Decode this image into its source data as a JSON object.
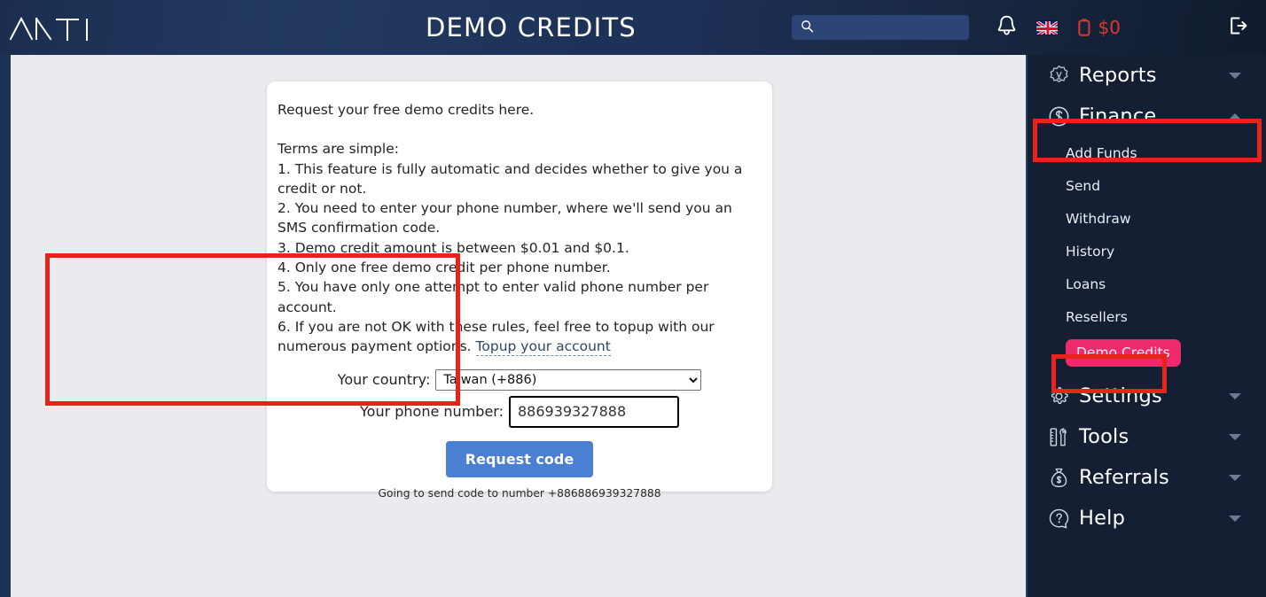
{
  "header": {
    "logo_alt": "ANTI logo",
    "title": "DEMO CREDITS",
    "search_placeholder": "",
    "search_value": "",
    "balance": "$0",
    "balance_color": "#e0352e",
    "language_flag": "united-kingdom"
  },
  "card": {
    "intro": "Request your free demo credits here.",
    "terms_heading": "Terms are simple:",
    "terms": [
      "1. This feature is fully automatic and decides whether to give you a credit or not.",
      "2. You need to enter your phone number, where we'll send you an SMS confirmation code.",
      "3. Demo credit amount is between $0.01 and $0.1.",
      "4. Only one free demo credit per phone number.",
      "5. You have only one attempt to enter valid phone number per account.",
      "6. If you are not OK with these rules, feel free to topup with our numerous payment options. "
    ],
    "topup_link": "Topup your account"
  },
  "form": {
    "country_label": "Your country:",
    "country_value": "Taiwan (+886)",
    "country_options": [
      "Taiwan (+886)"
    ],
    "phone_label": "Your phone number:",
    "phone_value": "886939327888",
    "phone_placeholder": "",
    "submit_label": "Request code",
    "submit_color": "#4a7fd1",
    "note": "Going to send code to number +886886939327888"
  },
  "sidebar": {
    "items": [
      {
        "label": "Reports",
        "icon": "badge-seal-icon",
        "caret": "down",
        "type": "top"
      },
      {
        "label": "Finance",
        "icon": "dollar-circle-icon",
        "caret": "up",
        "type": "top",
        "highlighted": true
      },
      {
        "label": "Add Funds",
        "type": "sub"
      },
      {
        "label": "Send",
        "type": "sub"
      },
      {
        "label": "Withdraw",
        "type": "sub"
      },
      {
        "label": "History",
        "type": "sub"
      },
      {
        "label": "Loans",
        "type": "sub"
      },
      {
        "label": "Resellers",
        "type": "sub"
      },
      {
        "label": "Demo Credits",
        "type": "sub",
        "active": true,
        "pill_color": "#ee2a6c"
      },
      {
        "label": "Settings",
        "icon": "gear-icon",
        "caret": "down",
        "type": "top"
      },
      {
        "label": "Tools",
        "icon": "ruler-wrench-icon",
        "caret": "down",
        "type": "top"
      },
      {
        "label": "Referrals",
        "icon": "money-bag-icon",
        "caret": "down",
        "type": "top"
      },
      {
        "label": "Help",
        "icon": "question-circle-icon",
        "caret": "down",
        "type": "top"
      }
    ]
  },
  "annotations": {
    "color": "#e8231a",
    "boxes": [
      "finance-nav-item",
      "demo-credits-nav-item",
      "request-code-form"
    ]
  }
}
